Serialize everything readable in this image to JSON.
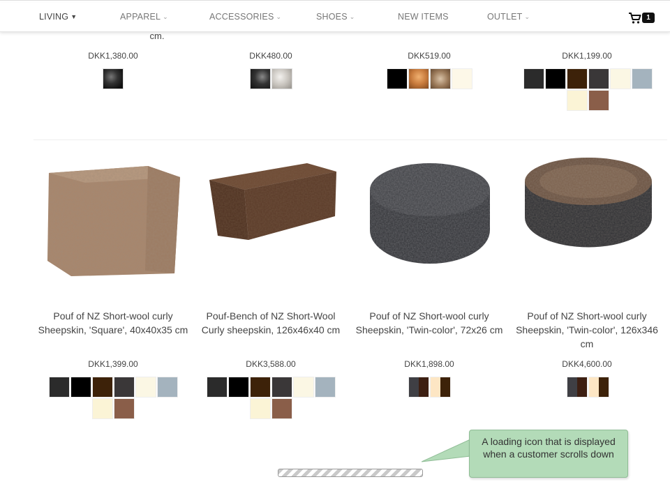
{
  "nav": {
    "items": [
      {
        "label": "LIVING",
        "dropdown": true,
        "active": true
      },
      {
        "label": "APPAREL",
        "dropdown": true
      },
      {
        "label": "ACCESSORIES",
        "dropdown": true
      },
      {
        "label": "SHOES",
        "dropdown": true
      },
      {
        "label": "NEW ITEMS",
        "dropdown": false
      },
      {
        "label": "OUTLET",
        "dropdown": true
      }
    ],
    "cart_count": "1",
    "cart_icon": "shopping-cart-icon"
  },
  "row1": {
    "cut_title_fragment": "cm.",
    "products": [
      {
        "price": "DKK1,380.00",
        "swatches": [
          "fur-black"
        ]
      },
      {
        "price": "DKK480.00",
        "swatches": [
          "fur-black",
          "fur-grey"
        ]
      },
      {
        "price": "DKK519.00",
        "swatches": [
          "#000000",
          "fur-orange",
          "fur-brown",
          "#fdf8e8"
        ]
      },
      {
        "price": "DKK1,199.00",
        "swatches": [
          "#2b2b2b",
          "#000000",
          "#3d2209",
          "#3a3738",
          "#fbf7e4",
          "#a4b3be",
          "#fbf4d6",
          "#8a5e49"
        ]
      }
    ]
  },
  "row2": {
    "products": [
      {
        "title": "Pouf of NZ Short-wool curly Sheepskin, 'Square', 40x40x35 cm",
        "price": "DKK1,399.00",
        "swatches": [
          "#2b2b2b",
          "#000000",
          "#3d2209",
          "#3a3738",
          "#fbf7e4",
          "#a4b3be",
          "#fbf4d6",
          "#8a5e49"
        ]
      },
      {
        "title": "Pouf-Bench of NZ Short-Wool Curly sheepskin, 126x46x40 cm",
        "price": "DKK3,588.00",
        "swatches": [
          "#2b2b2b",
          "#000000",
          "#3d2209",
          "#3a3738",
          "#fbf7e4",
          "#a4b3be",
          "#fbf4d6",
          "#8a5e49"
        ]
      },
      {
        "title": "Pouf of NZ Short-wool curly Sheepskin, 'Twin-color', 72x26 cm",
        "price": "DKK1,898.00",
        "swatches": [
          "twin-dark",
          "twin-cream"
        ]
      },
      {
        "title": "Pouf of NZ Short-wool curly Sheepskin, 'Twin-color', 126x346 cm",
        "price": "DKK4,600.00",
        "swatches": [
          "twin-dark",
          "twin-cream"
        ]
      }
    ]
  },
  "annotation": {
    "text": "A loading icon that is displayed when a customer scrolls down"
  }
}
